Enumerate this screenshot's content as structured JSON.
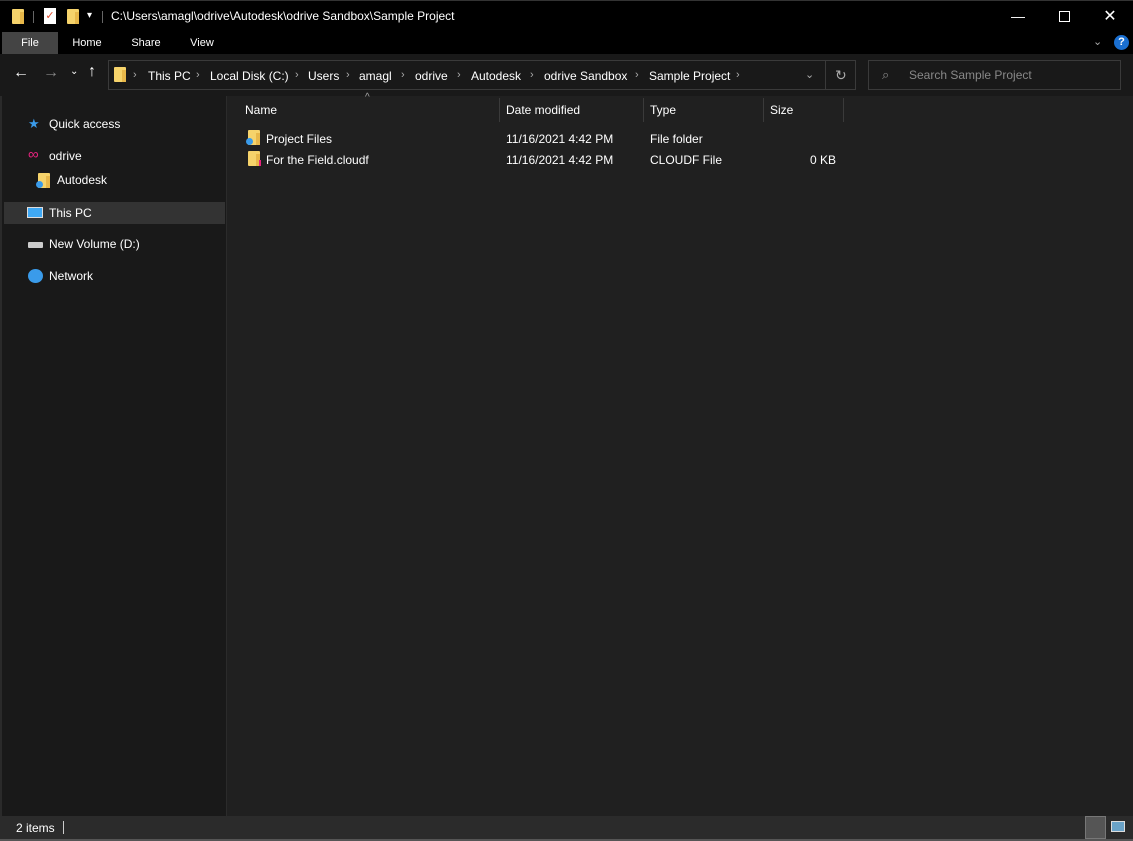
{
  "window": {
    "title": "C:\\Users\\amagl\\odrive\\Autodesk\\odrive Sandbox\\Sample Project"
  },
  "ribbon": {
    "tabs": [
      {
        "label": "File"
      },
      {
        "label": "Home"
      },
      {
        "label": "Share"
      },
      {
        "label": "View"
      }
    ]
  },
  "address": {
    "crumbs": [
      "This PC",
      "Local Disk (C:)",
      "Users",
      "amagl",
      "odrive",
      "Autodesk",
      "odrive Sandbox",
      "Sample Project"
    ]
  },
  "search": {
    "placeholder": "Search Sample Project"
  },
  "nav": {
    "items": [
      {
        "label": "Quick access"
      },
      {
        "label": "odrive"
      },
      {
        "label": "Autodesk"
      },
      {
        "label": "This PC"
      },
      {
        "label": "New Volume (D:)"
      },
      {
        "label": "Network"
      }
    ]
  },
  "columns": [
    "Name",
    "Date modified",
    "Type",
    "Size"
  ],
  "files": [
    {
      "name": "Project Files",
      "date": "11/16/2021 4:42 PM",
      "type": "File folder",
      "size": ""
    },
    {
      "name": "For the Field.cloudf",
      "date": "11/16/2021 4:42 PM",
      "type": "CLOUDF File",
      "size": "0 KB"
    }
  ],
  "status": {
    "count": "2 items"
  },
  "colors": {
    "odrive": "#e8237f",
    "accent": "#0078d7"
  }
}
